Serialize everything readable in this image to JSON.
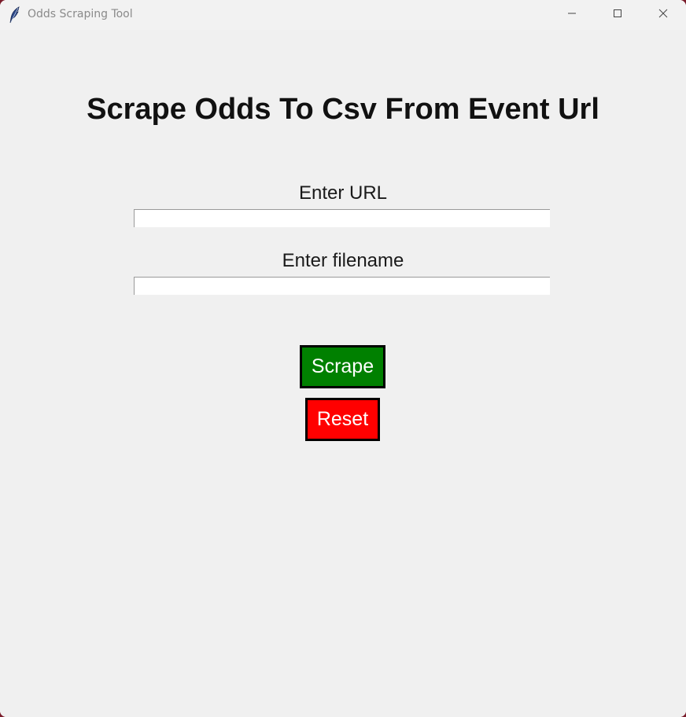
{
  "window": {
    "title": "Odds Scraping Tool",
    "icon": "feather-icon",
    "controls": {
      "minimize_icon": "minimize-icon",
      "maximize_icon": "maximize-icon",
      "close_icon": "close-icon"
    }
  },
  "main": {
    "heading": "Scrape Odds To Csv From Event Url",
    "url_field": {
      "label": "Enter URL",
      "value": "",
      "placeholder": ""
    },
    "filename_field": {
      "label": "Enter filename",
      "value": "",
      "placeholder": ""
    },
    "scrape_button": {
      "label": "Scrape",
      "color": "#008000"
    },
    "reset_button": {
      "label": "Reset",
      "color": "#ff0000"
    }
  },
  "colors": {
    "background": "#f0f0f0",
    "titlebar": "#f2f2f2"
  }
}
